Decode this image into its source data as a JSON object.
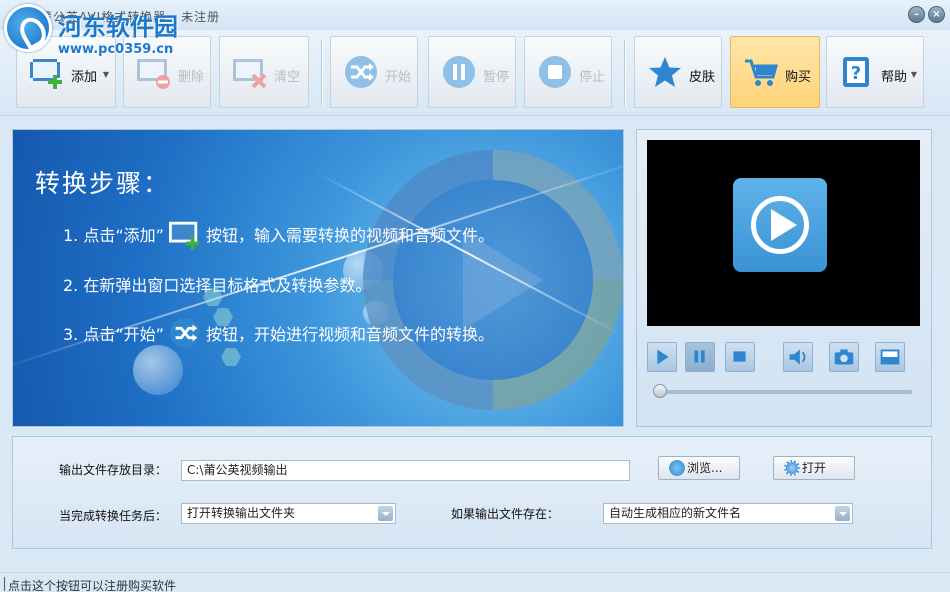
{
  "app": {
    "title": "莆公英AVI格式转换器 - 未注册",
    "watermark": "河东软件园",
    "watermark_url": "www.pc0359.cn"
  },
  "window": {
    "minimize_glyph": "–",
    "close_glyph": "×"
  },
  "toolbar": {
    "add": "添加",
    "delete": "删除",
    "clear": "清空",
    "start": "开始",
    "pause": "暂停",
    "stop": "停止",
    "skin": "皮肤",
    "buy": "购买",
    "help": "帮助"
  },
  "banner": {
    "title": "转换步骤：",
    "step1_pre": "1. 点击“添加”",
    "step1_post": "按钮，输入需要转换的视频和音频文件。",
    "step2": "2. 在新弹出窗口选择目标格式及转换参数。",
    "step3_pre": "3. 点击“开始”",
    "step3_post": "按钮，开始进行视频和音频文件的转换。"
  },
  "player": {
    "progress": 0.0
  },
  "settings": {
    "output_dir_label": "输出文件存放目录：",
    "output_dir_value": "C:\\莆公英视频输出",
    "browse": "浏览...",
    "open": "打开",
    "after_done_label": "当完成转换任务后：",
    "after_done_value": "打开转换输出文件夹",
    "if_exists_label": "如果输出文件存在：",
    "if_exists_value": "自动生成相应的新文件名"
  },
  "status": {
    "text": "点击这个按钮可以注册购买软件"
  },
  "colors": {
    "accent": "#1c78c9",
    "buy_bg": "#ffd27a",
    "banner": "#1e6fc5"
  },
  "icons": [
    "logo-icon",
    "add-video-icon",
    "delete-video-icon",
    "clear-video-icon",
    "shuffle-icon",
    "pause-icon",
    "stop-icon",
    "star-icon",
    "cart-icon",
    "help-icon",
    "play-icon",
    "volume-icon",
    "camera-icon",
    "fullscreen-icon",
    "browse-icon",
    "open-folder-icon"
  ]
}
